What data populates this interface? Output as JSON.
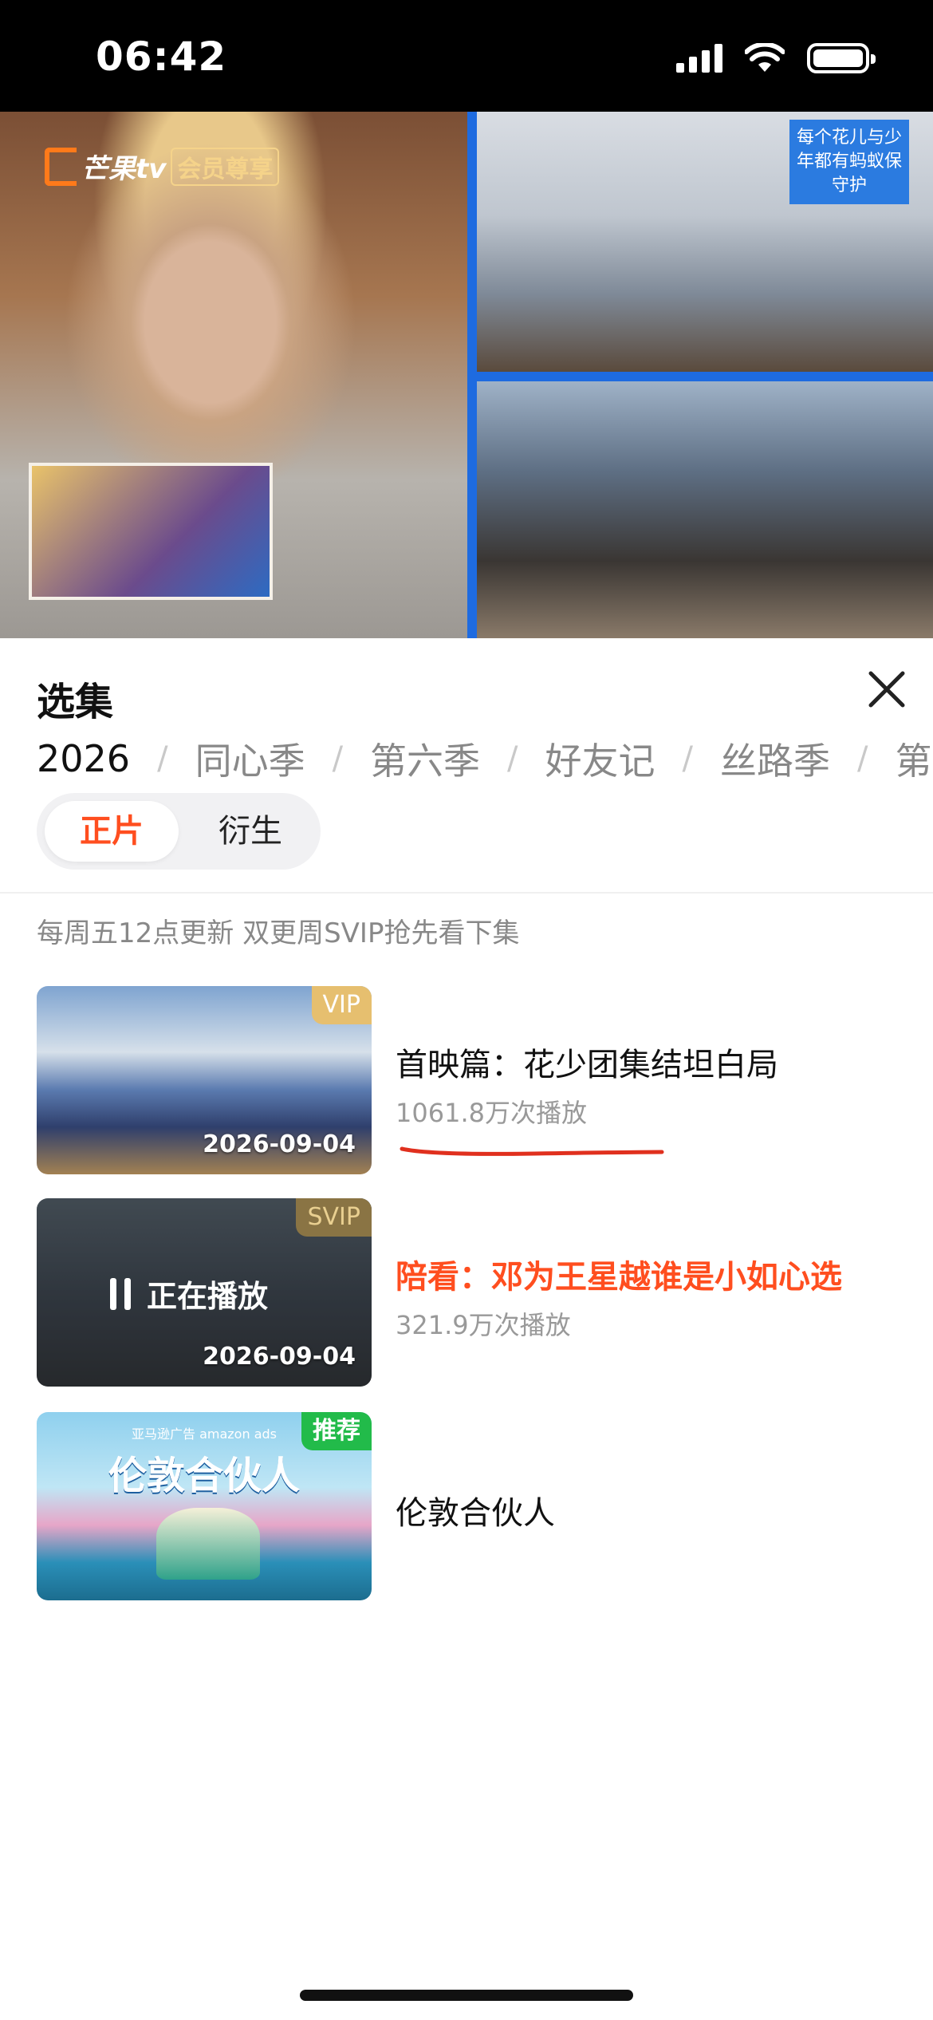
{
  "status_bar": {
    "time": "06:42"
  },
  "video": {
    "logo_text": "芒果tv",
    "logo_badge": "会员尊享",
    "sign_text": "每个花儿与少年都有蚂蚁保守护"
  },
  "panel": {
    "title": "选集"
  },
  "season_tabs": [
    {
      "label": "2026",
      "active": true
    },
    {
      "label": "同心季",
      "active": false
    },
    {
      "label": "第六季",
      "active": false
    },
    {
      "label": "好友记",
      "active": false
    },
    {
      "label": "丝路季",
      "active": false
    },
    {
      "label": "第",
      "active": false
    }
  ],
  "segmented": {
    "main": "正片",
    "derivative": "衍生"
  },
  "update_note": "每周五12点更新 双更周SVIP抢先看下集",
  "episodes": [
    {
      "badge": "VIP",
      "date": "2026-09-04",
      "title": "首映篇：花少团集结坦白局",
      "views": "1061.8万次播放"
    },
    {
      "badge": "SVIP",
      "date": "2026-09-04",
      "playing_label": "正在播放",
      "title": "陪看：邓为王星越谁是小如心选",
      "views": "321.9万次播放"
    },
    {
      "badge": "推荐",
      "thumb_title": "伦敦合伙人",
      "thumb_sub": "亚马逊广告 amazon ads",
      "title": "伦敦合伙人"
    }
  ],
  "colors": {
    "accent": "#ff4e1f",
    "vip": "#e6bf6f",
    "recommend": "#22bb4a",
    "underline": "#e0301e"
  }
}
